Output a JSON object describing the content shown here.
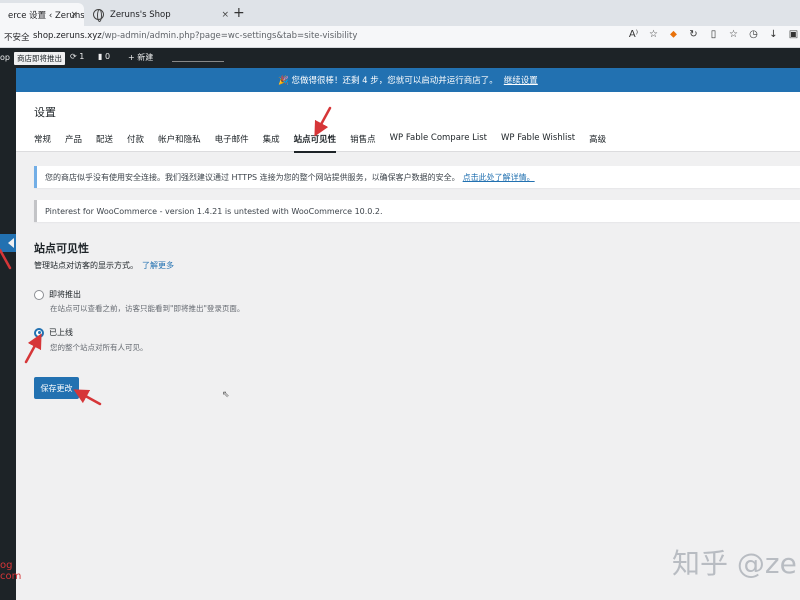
{
  "browser": {
    "active_tab_title": "erce 设置 ‹ Zeruns's S",
    "inactive_tab_title": "Zeruns's Shop",
    "tab_close": "×",
    "new_tab": "+",
    "security_label": "不安全",
    "url_host": "shop.zeruns.xyz",
    "url_path": "/wp-admin/admin.php?page=wc-settings&tab=site-visibility"
  },
  "adminbar": {
    "site_fragment": "op",
    "coming_soon_badge": "商店即将推出",
    "updates_count": "1",
    "comments_count": "0",
    "new_label": "新建"
  },
  "banner": {
    "text": "🎉 您做得很棒！还剩 4 步，您就可以启动并运行商店了。",
    "link": "继续设置"
  },
  "page": {
    "title": "设置",
    "tabs": [
      {
        "label": "常规"
      },
      {
        "label": "产品"
      },
      {
        "label": "配送"
      },
      {
        "label": "付款"
      },
      {
        "label": "帐户和隐私"
      },
      {
        "label": "电子邮件"
      },
      {
        "label": "集成"
      },
      {
        "label": "站点可见性"
      },
      {
        "label": "销售点"
      },
      {
        "label": "WP Fable Compare List"
      },
      {
        "label": "WP Fable Wishlist"
      },
      {
        "label": "高级"
      }
    ]
  },
  "notices": {
    "ssl_text": "您的商店似乎没有使用安全连接。我们强烈建议通过 HTTPS 连接为您的整个网站提供服务，以确保客户数据的安全。",
    "ssl_link": "点击此处了解详情。",
    "pinterest_text": "Pinterest for WooCommerce - version 1.4.21 is untested with WooCommerce 10.0.2."
  },
  "visibility": {
    "title": "站点可见性",
    "description": "管理站点对访客的显示方式。",
    "learn_more": "了解更多",
    "option_coming_soon": "即将推出",
    "option_coming_soon_help": "在站点可以查看之前，访客只能看到\"即将推出\"登录页面。",
    "option_live": "已上线",
    "option_live_help": "您的整个站点对所有人可见。",
    "save_label": "保存更改"
  },
  "watermark": {
    "main": "知乎 @ze",
    "left": "og\ncom"
  },
  "colors": {
    "wp_blue": "#2271b1",
    "admin_dark": "#1d2327",
    "annotation_red": "#d63638"
  }
}
